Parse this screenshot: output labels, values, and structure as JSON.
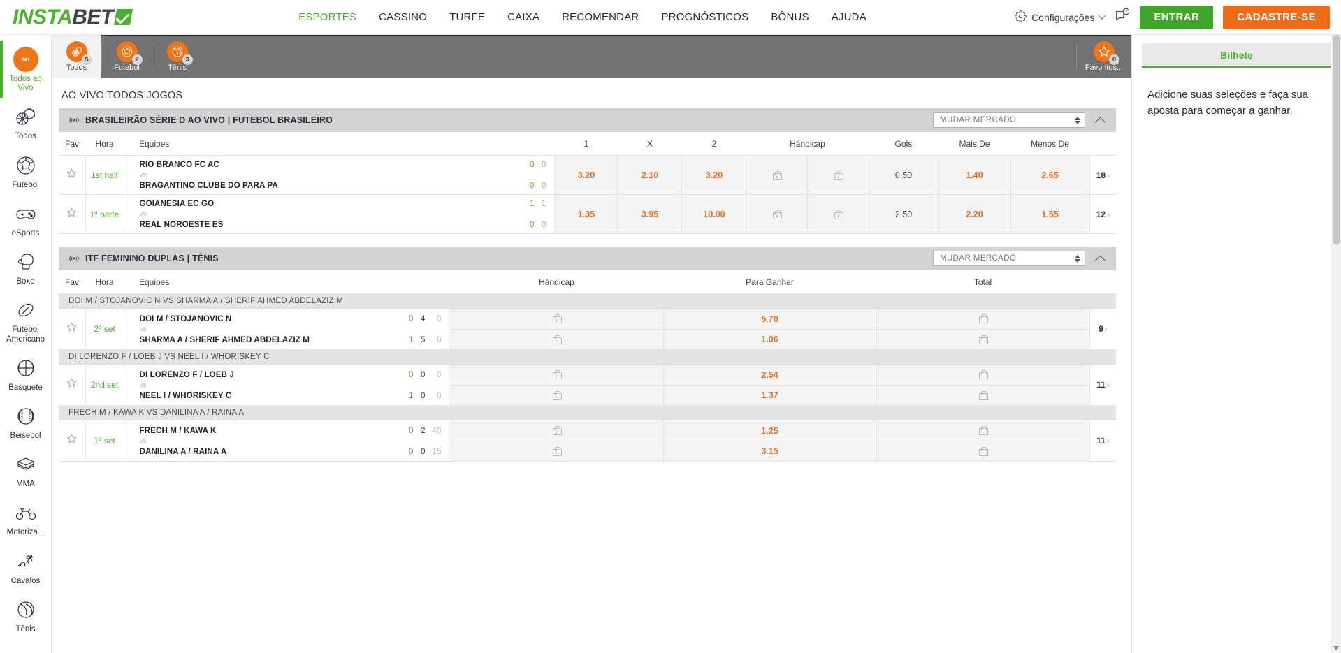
{
  "brand": {
    "part1": "INSTA",
    "part2": "BET",
    "check_icon": "check-icon"
  },
  "nav": [
    {
      "label": "ESPORTES",
      "active": true
    },
    {
      "label": "CASSINO",
      "active": false
    },
    {
      "label": "TURFE",
      "active": false
    },
    {
      "label": "CAIXA",
      "active": false
    },
    {
      "label": "RECOMENDAR",
      "active": false
    },
    {
      "label": "PROGNÓSTICOS",
      "active": false
    },
    {
      "label": "BÔNUS",
      "active": false
    },
    {
      "label": "AJUDA",
      "active": false
    }
  ],
  "topright": {
    "settings_label": "Configurações",
    "login_label": "ENTRAR",
    "signup_label": "CADASTRE-SE"
  },
  "sidebar": {
    "items": [
      {
        "label": "Todos ao Vivo",
        "icon": "live-broadcast-icon",
        "active": true
      },
      {
        "label": "Todos",
        "icon": "all-sports-icon",
        "active": false
      },
      {
        "label": "Futebol",
        "icon": "soccer-ball-icon",
        "active": false
      },
      {
        "label": "eSports",
        "icon": "gamepad-icon",
        "active": false
      },
      {
        "label": "Boxe",
        "icon": "boxing-glove-icon",
        "active": false
      },
      {
        "label": "Futebol Americano",
        "icon": "american-football-icon",
        "active": false
      },
      {
        "label": "Basquete",
        "icon": "basketball-icon",
        "active": false
      },
      {
        "label": "Beisebol",
        "icon": "baseball-icon",
        "active": false
      },
      {
        "label": "MMA",
        "icon": "mma-ring-icon",
        "active": false
      },
      {
        "label": "Motoriza...",
        "icon": "motorcycle-icon",
        "active": false
      },
      {
        "label": "Cavalos",
        "icon": "horse-racing-icon",
        "active": false
      },
      {
        "label": "Tênis",
        "icon": "tennis-ball-icon",
        "active": false
      }
    ]
  },
  "tabs": [
    {
      "label": "Todos",
      "badge": "5",
      "icon": "all-sports-icon",
      "active": true
    },
    {
      "label": "Futebol",
      "badge": "2",
      "icon": "soccer-ball-icon",
      "active": false
    },
    {
      "label": "Tênis",
      "badge": "3",
      "icon": "tennis-ball-icon",
      "active": false
    }
  ],
  "favorites_tab": {
    "label": "Favoritos...",
    "badge": "0",
    "icon": "star-icon"
  },
  "page_heading": "AO VIVO TODOS JOGOS",
  "market_select": {
    "value": "MUDAR MERCADO"
  },
  "sections": [
    {
      "id": "futebol",
      "league": "BRASILEIRÃO SÉRIE D AO VIVO | FUTEBOL BRASILEIRO",
      "columns": [
        "Fav",
        "Hora",
        "Equipes",
        "1",
        "X",
        "2",
        "Hándicap",
        "Gols",
        "Mais De",
        "Menos De"
      ],
      "matches": [
        {
          "time": "1st half",
          "home": "RIO BRANCO FC AC",
          "away": "BRAGANTINO CLUBE DO PARA PA",
          "vs": "vs",
          "home_scores": [
            "0",
            "0"
          ],
          "away_scores": [
            "0",
            "0"
          ],
          "odds": {
            "one": "3.20",
            "x": "2.10",
            "two": "3.20",
            "handicap_a": "lock",
            "handicap_b": "lock",
            "gols": "0.50",
            "mais_de": "1.40",
            "menos_de": "2.65"
          },
          "more_count": "18"
        },
        {
          "time": "1ª parte",
          "home": "GOIANESIA EC GO",
          "away": "REAL NOROESTE ES",
          "vs": "vs",
          "home_scores": [
            "1",
            "1"
          ],
          "away_scores": [
            "0",
            "0"
          ],
          "odds": {
            "one": "1.35",
            "x": "3.95",
            "two": "10.00",
            "handicap_a": "lock",
            "handicap_b": "lock",
            "gols": "2.50",
            "mais_de": "2.20",
            "menos_de": "1.55"
          },
          "more_count": "12"
        }
      ]
    },
    {
      "id": "tenis",
      "league": "ITF FEMININO DUPLAS | TÊNIS",
      "columns": [
        "Fav",
        "Hora",
        "Equipes",
        "Hándicap",
        "Para Ganhar",
        "Total"
      ],
      "matches": [
        {
          "group": "DOI M / STOJANOVIC N VS SHARMA A / SHERIF AHMED ABDELAZIZ M",
          "time": "2º set",
          "home": "DOI M / STOJANOVIC N",
          "away": "SHARMA A / SHERIF AHMED ABDELAZIZ M",
          "vs": "vs",
          "home_scores": [
            "0",
            "4",
            "0"
          ],
          "away_scores": [
            "1",
            "5",
            "0"
          ],
          "odds": {
            "handicap_home": "lock",
            "handicap_away": "lock",
            "win_home": "5.70",
            "win_away": "1.06",
            "total_over": "lock",
            "total_under": "lock"
          },
          "more_count": "9"
        },
        {
          "group": "DI LORENZO F / LOEB J VS NEEL I / WHORISKEY C",
          "time": "2nd set",
          "home": "DI LORENZO F / LOEB J",
          "away": "NEEL I / WHORISKEY C",
          "vs": "vs",
          "home_scores": [
            "0",
            "0",
            "0"
          ],
          "away_scores": [
            "1",
            "0",
            "0"
          ],
          "odds": {
            "handicap_home": "lock",
            "handicap_away": "lock",
            "win_home": "2.54",
            "win_away": "1.37",
            "total_over": "lock",
            "total_under": "lock"
          },
          "more_count": "11"
        },
        {
          "group": "FRECH M / KAWA K VS DANILINA A / RAINA A",
          "time": "1º set",
          "home": "FRECH M / KAWA K",
          "away": "DANILINA A / RAINA A",
          "vs": "vs",
          "home_scores": [
            "0",
            "2",
            "40"
          ],
          "away_scores": [
            "0",
            "0",
            "15"
          ],
          "odds": {
            "handicap_home": "lock",
            "handicap_away": "lock",
            "win_home": "1.25",
            "win_away": "3.15",
            "total_over": "lock",
            "total_under": "lock"
          },
          "more_count": "11"
        }
      ]
    }
  ],
  "betslip": {
    "title": "Bilhete",
    "empty_message": "Adicione suas seleções e faça sua aposta para começar a ganhar."
  },
  "colors": {
    "brand_green": "#4caf2e",
    "accent_orange": "#ef6c1a",
    "odds_orange": "#ee6a22",
    "tab_bar": "#727272",
    "league_header": "#d2d2d2"
  }
}
